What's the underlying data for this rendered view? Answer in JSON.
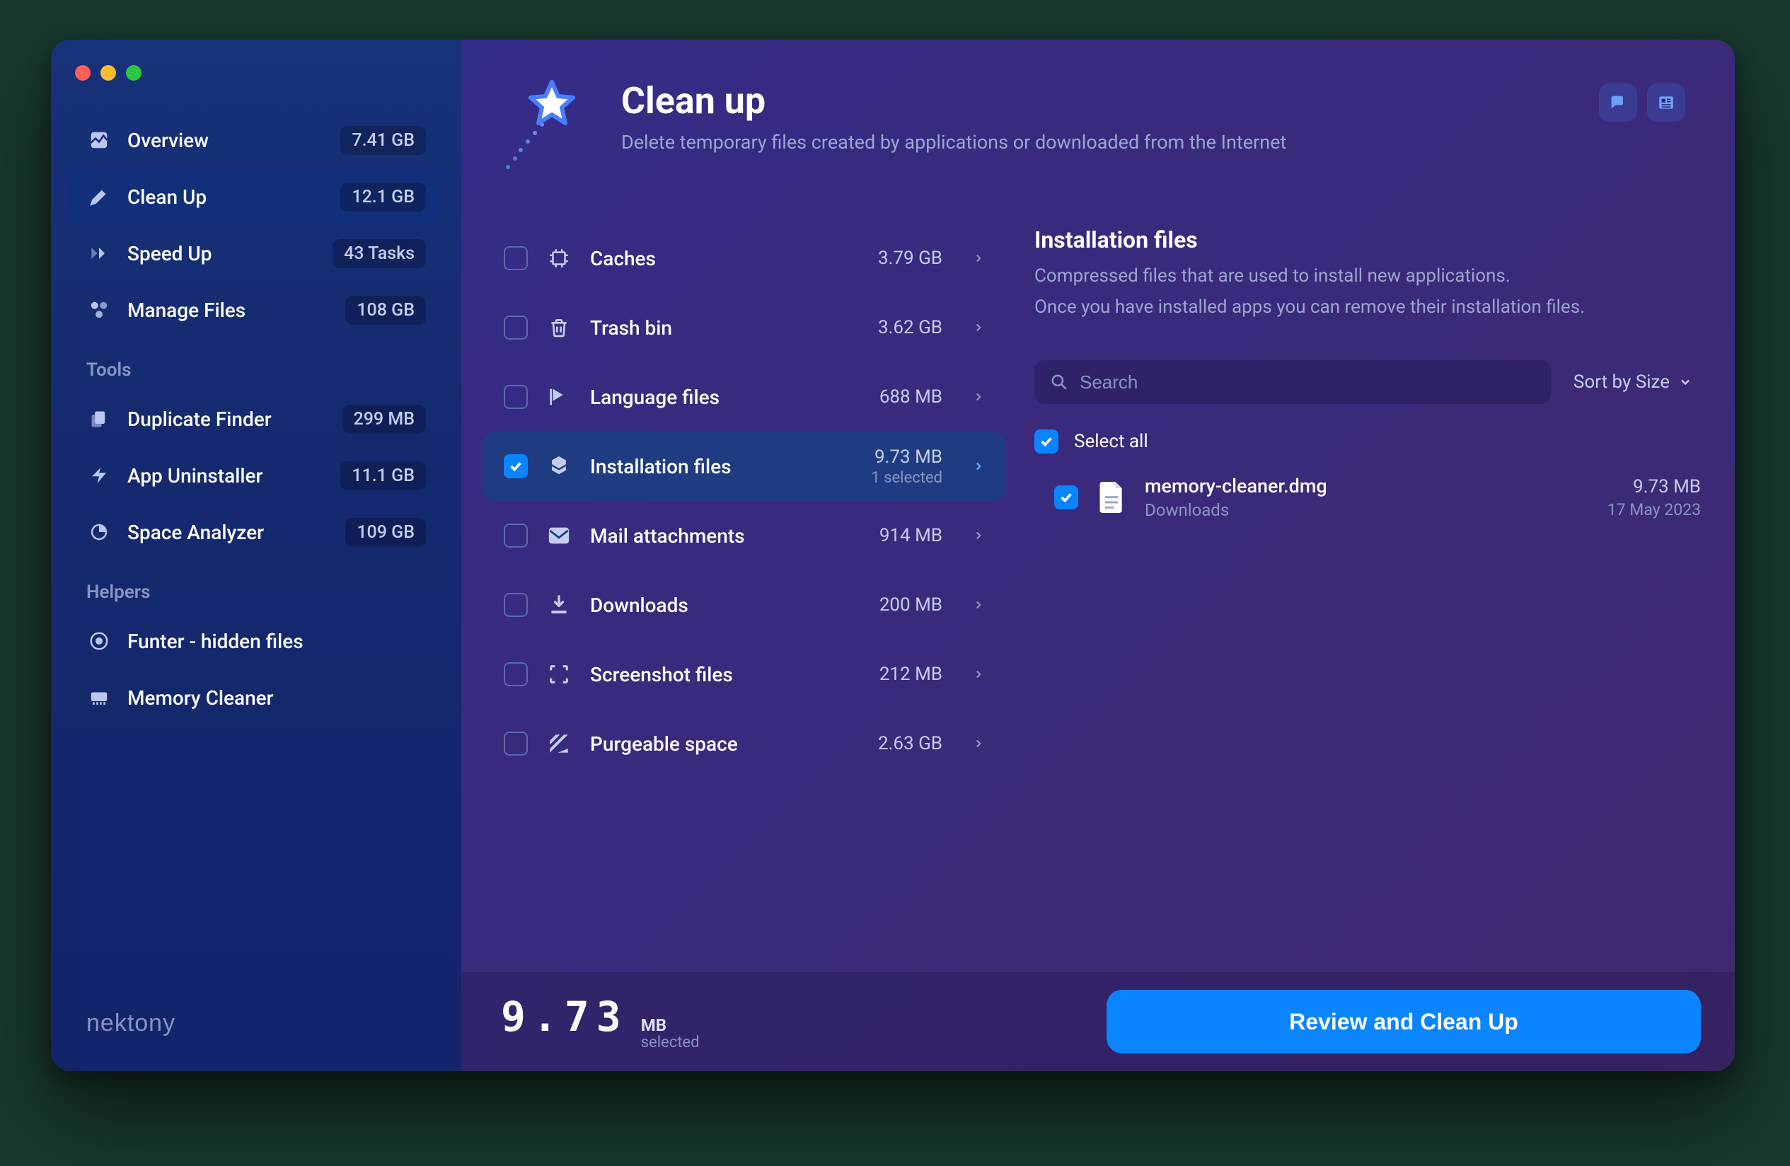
{
  "brand": "nektony",
  "header": {
    "title": "Clean up",
    "subtitle": "Delete temporary files created by applications or downloaded from the Internet"
  },
  "sidebar": {
    "main": [
      {
        "icon": "overview",
        "label": "Overview",
        "badge": "7.41 GB",
        "active": false
      },
      {
        "icon": "cleanup",
        "label": "Clean Up",
        "badge": "12.1 GB",
        "active": true
      },
      {
        "icon": "speedup",
        "label": "Speed Up",
        "badge": "43 Tasks",
        "active": false
      },
      {
        "icon": "manage",
        "label": "Manage Files",
        "badge": "108 GB",
        "active": false
      }
    ],
    "tools_title": "Tools",
    "tools": [
      {
        "icon": "duplicate",
        "label": "Duplicate Finder",
        "badge": "299 MB"
      },
      {
        "icon": "uninstall",
        "label": "App Uninstaller",
        "badge": "11.1 GB"
      },
      {
        "icon": "space",
        "label": "Space Analyzer",
        "badge": "109 GB"
      }
    ],
    "helpers_title": "Helpers",
    "helpers": [
      {
        "icon": "funter",
        "label": "Funter - hidden files"
      },
      {
        "icon": "memory",
        "label": "Memory Cleaner"
      }
    ]
  },
  "categories": [
    {
      "id": "caches",
      "label": "Caches",
      "size": "3.79 GB",
      "checked": false
    },
    {
      "id": "trash",
      "label": "Trash bin",
      "size": "3.62 GB",
      "checked": false
    },
    {
      "id": "language",
      "label": "Language files",
      "size": "688 MB",
      "checked": false
    },
    {
      "id": "install",
      "label": "Installation files",
      "size": "9.73 MB",
      "sub": "1 selected",
      "checked": true,
      "selected": true
    },
    {
      "id": "mail",
      "label": "Mail attachments",
      "size": "914 MB",
      "checked": false
    },
    {
      "id": "downloads",
      "label": "Downloads",
      "size": "200 MB",
      "checked": false
    },
    {
      "id": "screenshot",
      "label": "Screenshot files",
      "size": "212 MB",
      "checked": false
    },
    {
      "id": "purgeable",
      "label": "Purgeable space",
      "size": "2.63 GB",
      "checked": false
    }
  ],
  "detail": {
    "title": "Installation files",
    "desc1": "Compressed files that are used to install new applications.",
    "desc2": "Once you have installed apps you can remove their installation files.",
    "search_placeholder": "Search",
    "sort_label": "Sort by Size",
    "select_all": "Select all",
    "select_all_checked": true,
    "files": [
      {
        "name": "memory-cleaner.dmg",
        "folder": "Downloads",
        "size": "9.73 MB",
        "date": "17 May 2023",
        "checked": true
      }
    ]
  },
  "footer": {
    "amount": "9.73",
    "unit": "MB",
    "label": "selected",
    "cta": "Review and Clean Up"
  }
}
